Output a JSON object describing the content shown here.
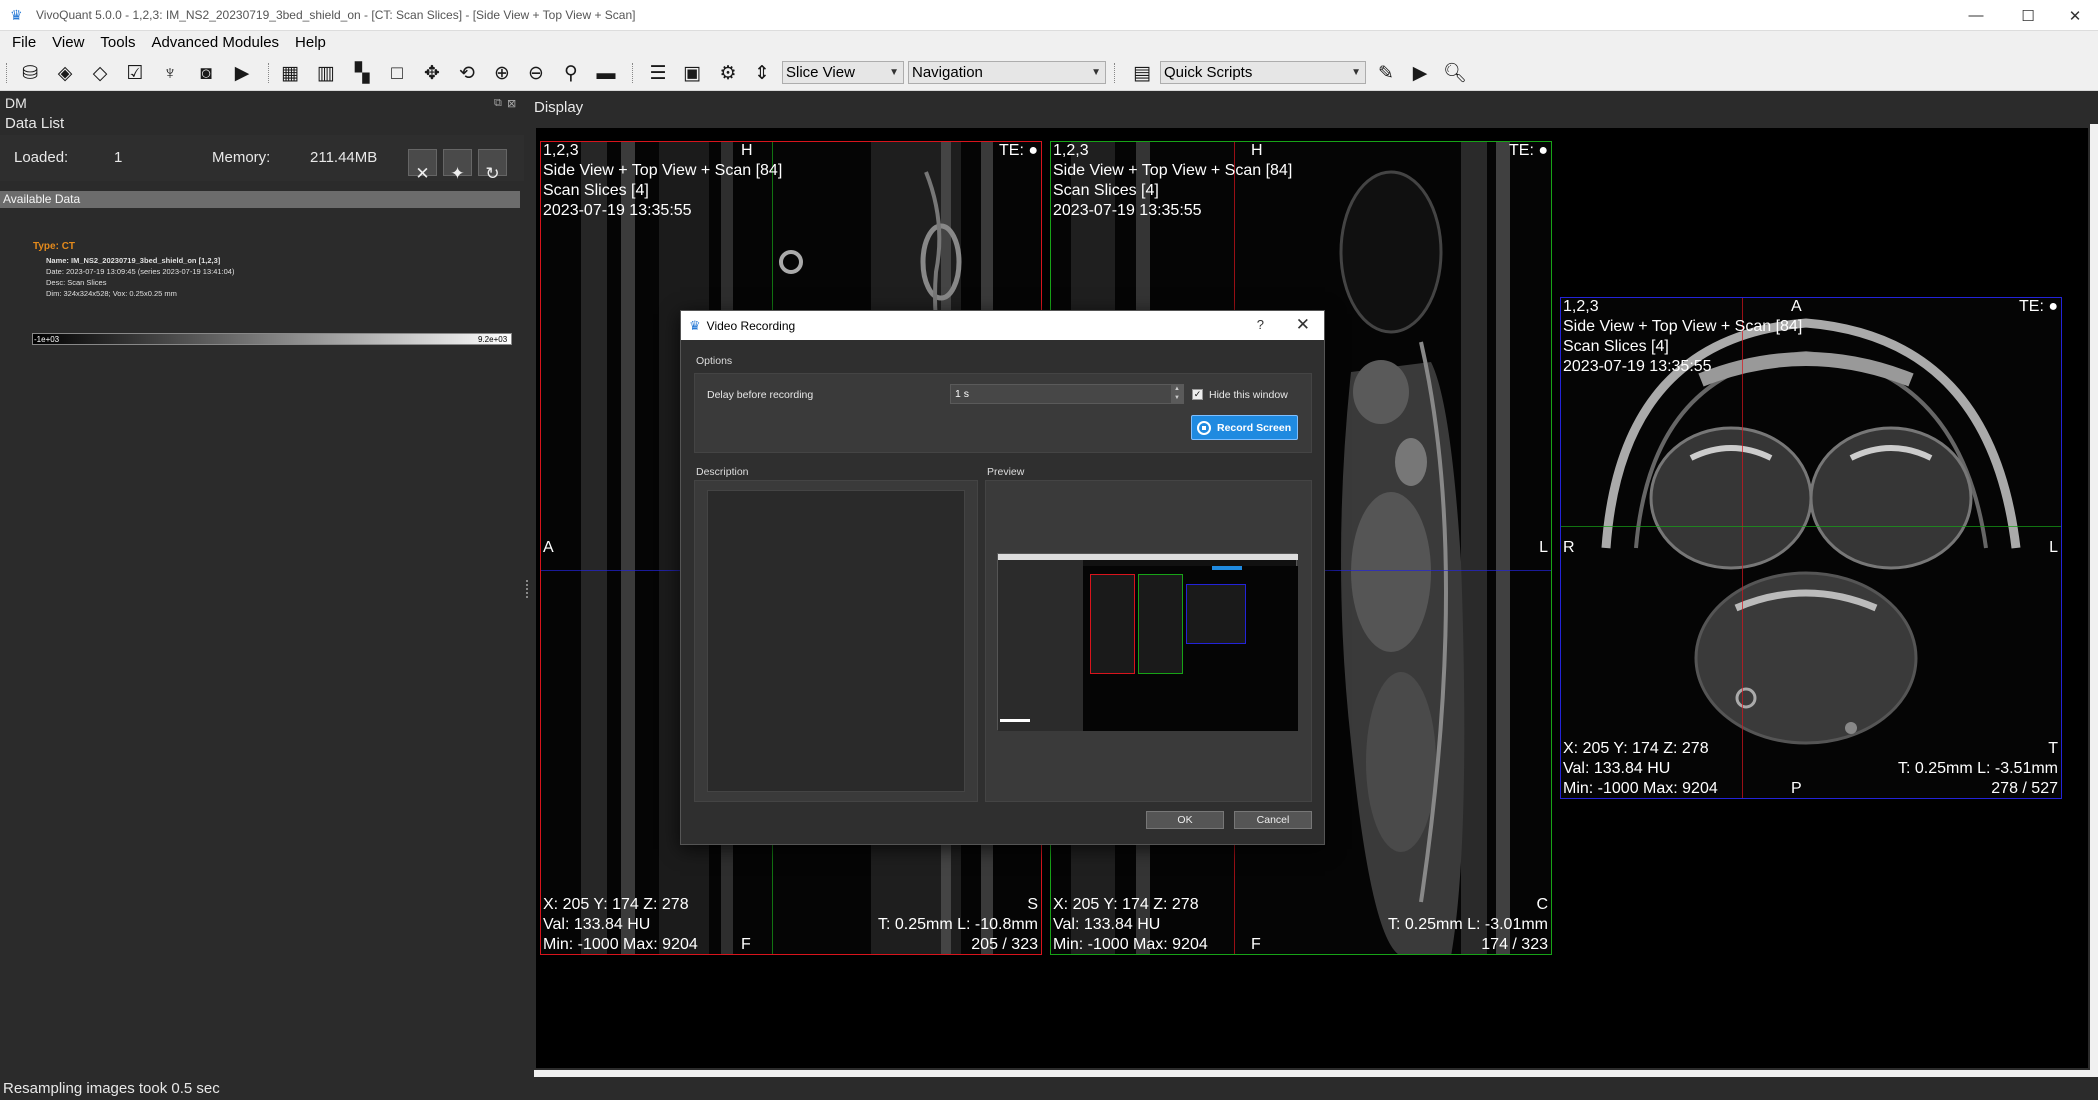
{
  "window": {
    "title": "VivoQuant 5.0.0 - 1,2,3: IM_NS2_20230719_3bed_shield_on - [CT: Scan Slices] - [Side View + Top View + Scan]",
    "minimize": "—",
    "maximize": "☐",
    "close": "✕"
  },
  "menu": {
    "file": "File",
    "view": "View",
    "tools": "Tools",
    "advanced": "Advanced Modules",
    "help": "Help"
  },
  "toolbar": {
    "slice_view": "Slice View",
    "navigation": "Navigation",
    "quick_scripts": "Quick Scripts",
    "icons": [
      "database-icon",
      "layers-icon",
      "layers-stack-icon",
      "clipboard-check-icon",
      "tooth-icon",
      "camera-icon",
      "video-camera-icon",
      "grid-2x2-icon",
      "columns-icon",
      "layout-icon",
      "square-icon",
      "pan-icon",
      "rotate-icon",
      "zoom-in-icon",
      "zoom-out-icon",
      "search-icon",
      "ruler-icon",
      "sliders-icon",
      "mc-icon",
      "gear-dm-icon",
      "fit-height-icon",
      "document-icon",
      "pencil-icon",
      "play-icon",
      "inspect-icon"
    ]
  },
  "dm": {
    "title": "DM",
    "subtitle": "Data List",
    "loaded_label": "Loaded:",
    "loaded_value": "1",
    "memory_label": "Memory:",
    "memory_value": "211.44MB",
    "available_label": "Available Data",
    "item": {
      "type": "Type: CT",
      "name": "Name: IM_NS2_20230719_3bed_shield_on [1,2,3]",
      "date": "Date: 2023-07-19 13:09:45 (series 2023-07-19 13:41:04)",
      "desc": "Desc: Scan Slices",
      "dim": "Dim: 324x324x528; Vox: 0.25x0.25 mm"
    },
    "cmap_min": "-1e+03",
    "cmap_max": "9.2e+03"
  },
  "display": {
    "label": "Display",
    "views": [
      {
        "id": "1,2,3",
        "line1": "Side View + Top View + Scan [84]",
        "line2": "Scan Slices [4]",
        "line3": "2023-07-19 13:35:55",
        "te": "TE: ●",
        "top": "H",
        "left": "A",
        "right": "",
        "bottom": "F",
        "br_corner": "S",
        "coords": "X: 205 Y: 174 Z: 278",
        "val": "Val: 133.84 HU",
        "minmax": "Min: -1000 Max: 9204",
        "tl": "T: 0.25mm L: -10.8mm",
        "slice": "205 / 323"
      },
      {
        "id": "1,2,3",
        "line1": "Side View + Top View + Scan [84]",
        "line2": "Scan Slices [4]",
        "line3": "2023-07-19 13:35:55",
        "te": "TE: ●",
        "top": "H",
        "left": "",
        "right": "L",
        "bottom": "F",
        "br_corner": "C",
        "coords": "X: 205 Y: 174 Z: 278",
        "val": "Val: 133.84 HU",
        "minmax": "Min: -1000 Max: 9204",
        "tl": "T: 0.25mm L: -3.01mm",
        "slice": "174 / 323"
      },
      {
        "id": "1,2,3",
        "line1": "Side View + Top View + Scan [84]",
        "line2": "Scan Slices [4]",
        "line3": "2023-07-19 13:35:55",
        "te": "TE: ●",
        "top": "A",
        "left": "R",
        "right": "L",
        "bottom": "P",
        "br_corner": "T",
        "coords": "X: 205 Y: 174 Z: 278",
        "val": "Val: 133.84 HU",
        "minmax": "Min: -1000 Max: 9204",
        "tl": "T: 0.25mm L: -3.51mm",
        "slice": "278 / 527"
      }
    ]
  },
  "dialog": {
    "title": "Video Recording",
    "help": "?",
    "close": "✕",
    "options_label": "Options",
    "delay_label": "Delay before recording",
    "delay_value": "1 s",
    "hide_label": "Hide this window",
    "hide_checked": "✓",
    "record_label": "Record Screen",
    "description_label": "Description",
    "preview_label": "Preview",
    "ok_label": "OK",
    "cancel_label": "Cancel"
  },
  "status": {
    "text": "Resampling images took 0.5 sec"
  },
  "colors": {
    "view1_border": "#d8141c",
    "view2_border": "#17a317",
    "view3_border": "#2323d8",
    "accent": "#1f8ae0",
    "type_label": "#e48a1c"
  }
}
